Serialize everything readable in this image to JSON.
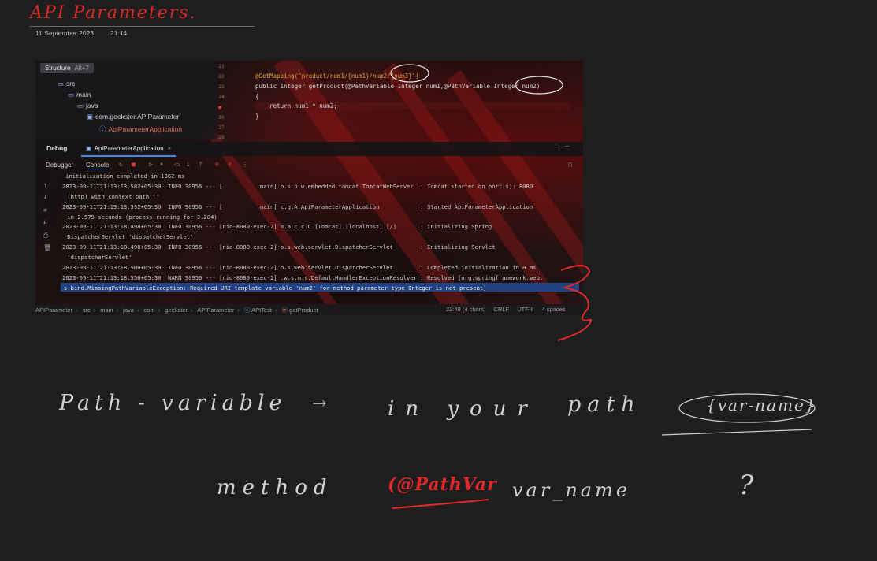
{
  "note": {
    "title": "API Parameters.",
    "date": "11 September 2023",
    "time": "21:14",
    "ink_colors": {
      "red": "#d92a2a",
      "white": "#cfcfcf"
    }
  },
  "ide": {
    "structure_tab": "Structure",
    "structure_shortcut": "Alt+7",
    "tree": [
      {
        "label": "src",
        "icon": "folder-icon"
      },
      {
        "label": "main",
        "icon": "folder-icon"
      },
      {
        "label": "java",
        "icon": "folder-icon"
      },
      {
        "label": "com.geekster.APIParameter",
        "icon": "package-icon"
      },
      {
        "label": "ApiParameterApplication",
        "icon": "class-icon"
      }
    ],
    "code_lines": [
      {
        "num": "21",
        "text": ""
      },
      {
        "num": "22",
        "text": "@GetMapping(\"product/num1/{num1}/num2/{num3}\")"
      },
      {
        "num": "23",
        "text": "public Integer getProduct(@PathVariable Integer num1,@PathVariable Integer num2)"
      },
      {
        "num": "24",
        "text": "{"
      },
      {
        "num": "25",
        "text": "    return num1 * num2;"
      },
      {
        "num": "26",
        "text": "}"
      },
      {
        "num": "27",
        "text": ""
      },
      {
        "num": "28",
        "text": ""
      }
    ],
    "debug_label": "Debug",
    "debug_tab": "ApiParameterApplication",
    "subtabs": [
      "Debugger",
      "Console"
    ],
    "console_lines": [
      "initialization completed in 1362 ms",
      "2023-09-11T21:13:13.582+05:30  INFO 30956 --- [           main] o.s.b.w.embedded.tomcat.TomcatWebServer  : Tomcat started on port(s): 8080",
      " (http) with context path ''",
      "2023-09-11T21:13:13.592+05:30  INFO 30956 --- [           main] c.g.A.ApiParameterApplication            : Started ApiParameterApplication",
      " in 2.575 seconds (process running for 3.204)",
      "2023-09-11T21:13:18.498+05:30  INFO 30956 --- [nio-8080-exec-2] o.a.c.c.C.[Tomcat].[localhost].[/]       : Initializing Spring",
      " DispatcherServlet 'dispatcherServlet'",
      "2023-09-11T21:13:18.498+05:30  INFO 30956 --- [nio-8080-exec-2] o.s.web.servlet.DispatcherServlet        : Initializing Servlet",
      " 'dispatcherServlet'",
      "2023-09-11T21:13:18.500+05:30  INFO 30956 --- [nio-8080-exec-2] o.s.web.servlet.DispatcherServlet        : Completed initialization in 0 ms",
      "2023-09-11T21:13:18.556+05:30  WARN 30956 --- [nio-8080-exec-2] .w.s.m.s.DefaultHandlerExceptionResolver : Resolved [org.springframework.web.",
      "s.bind.MissingPathVariableException: Required URI template variable 'num2' for method parameter type Integer is not present]"
    ],
    "breadcrumbs": [
      "APIParameter",
      "src",
      "main",
      "java",
      "com",
      "geekster",
      "APIParameter",
      "APITest",
      "getProduct"
    ],
    "status_right": [
      "22:48 (4 chars)",
      "CRLF",
      "UTF-8",
      "4 spaces"
    ]
  },
  "handwriting": {
    "line1_a": "Path - variable",
    "line1_arrow": "→",
    "line1_b": "in your",
    "line1_c": "path",
    "line1_d": "{var-name}",
    "line2_a": "method",
    "line2_b": "(@PathVar",
    "line2_c": "var_name",
    "line2_q": "?"
  }
}
